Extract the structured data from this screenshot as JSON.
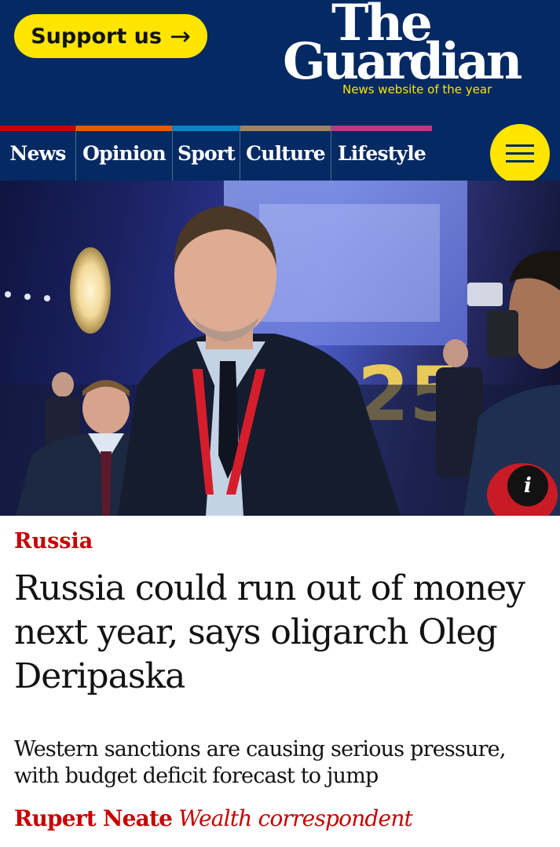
{
  "header": {
    "support_label": "Support us",
    "support_arrow": "→",
    "logo_line1": "The",
    "logo_line2": "Guardian",
    "tagline": "News website of the year",
    "brand_color": "#052962",
    "accent_color": "#ffe500"
  },
  "nav": {
    "items": [
      {
        "label": "News",
        "color": "#c70000"
      },
      {
        "label": "Opinion",
        "color": "#e05e00"
      },
      {
        "label": "Sport",
        "color": "#0084c6"
      },
      {
        "label": "Culture",
        "color": "#a1845c"
      },
      {
        "label": "Lifestyle",
        "color": "#bb3b80"
      }
    ],
    "menu_icon": "hamburger-menu-icon"
  },
  "image": {
    "info_label": "i",
    "info_icon": "info-icon"
  },
  "article": {
    "kicker": "Russia",
    "headline": "Russia could run out of money next year, says oligarch Oleg Deripaska",
    "standfirst": "Western sanctions are causing serious pressure, with budget deficit forecast to jump",
    "byline_author": "Rupert Neate",
    "byline_role": "Wealth correspondent",
    "kicker_color": "#c70000"
  }
}
